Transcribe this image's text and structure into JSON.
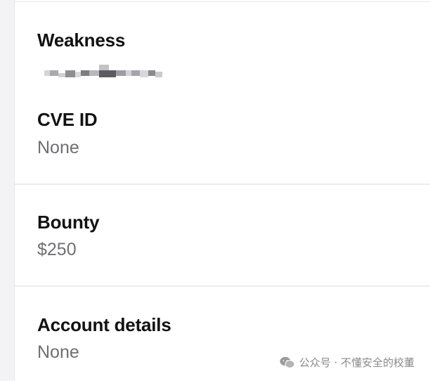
{
  "fields": [
    {
      "label": "Weakness",
      "value_redacted": true
    },
    {
      "label": "CVE ID",
      "value": "None"
    },
    {
      "label": "Bounty",
      "value": "$250"
    },
    {
      "label": "Account details",
      "value": "None"
    }
  ],
  "watermark": {
    "text": "公众号 · 不懂安全的校董",
    "icon": "wechat-icon"
  }
}
